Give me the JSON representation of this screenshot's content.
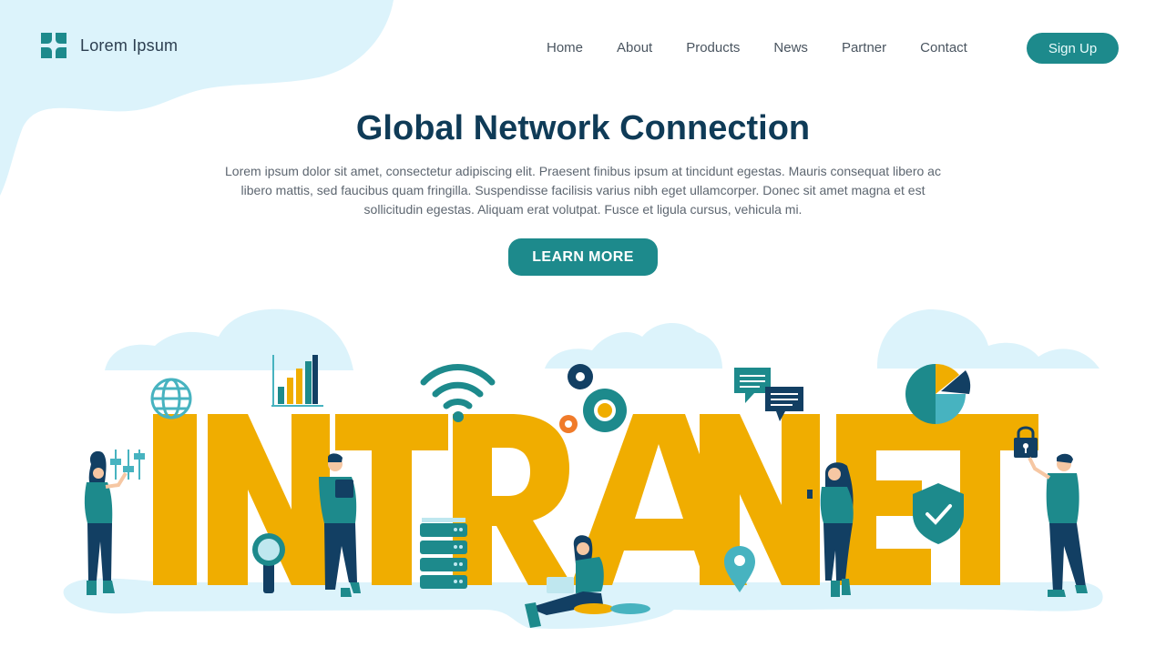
{
  "brand": {
    "name": "Lorem Ipsum",
    "logo_icon": "four-petal-logo-icon"
  },
  "nav": {
    "items": [
      {
        "label": "Home"
      },
      {
        "label": "About"
      },
      {
        "label": "Products"
      },
      {
        "label": "News"
      },
      {
        "label": "Partner"
      },
      {
        "label": "Contact"
      }
    ],
    "signup_label": "Sign Up"
  },
  "hero": {
    "title": "Global Network Connection",
    "body": "Lorem ipsum dolor sit amet, consectetur adipiscing elit. Praesent finibus ipsum at tincidunt egestas. Mauris consequat libero ac libero mattis, sed faucibus quam fringilla. Suspendisse facilisis varius nibh eget ullamcorper. Donec sit amet magna et est sollicitudin egestas. Aliquam erat volutpat. Fusce et ligula cursus, vehicula mi.",
    "cta_label": "LEARN MORE"
  },
  "illustration": {
    "word": "INTRANET",
    "icons": [
      "globe-icon",
      "bar-chart-icon",
      "wifi-icon",
      "gears-icon",
      "chat-bubbles-icon",
      "pie-chart-icon",
      "padlock-icon",
      "shield-check-icon",
      "magnifier-icon",
      "server-stack-icon",
      "location-pin-icon",
      "sliders-icon",
      "laptop-icon",
      "tablet-icon",
      "phone-icon"
    ]
  },
  "colors": {
    "primary": "#1d8a8c",
    "title": "#0f3b57",
    "letters": "#f0ad00",
    "cloud": "#dcf3fb",
    "dark_blue": "#123f63"
  }
}
